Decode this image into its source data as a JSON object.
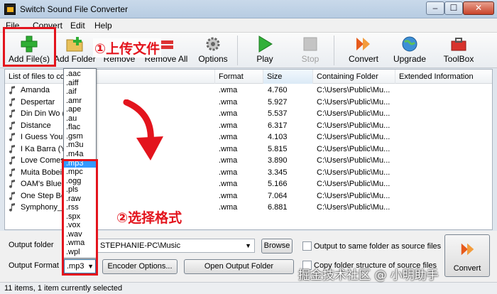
{
  "window": {
    "title": "Switch Sound File Converter"
  },
  "menu": [
    "File",
    "Convert",
    "Edit",
    "Help"
  ],
  "toolbar": {
    "add_files": "Add File(s)",
    "add_folder": "Add Folder",
    "remove": "Remove",
    "remove_all": "Remove All",
    "options": "Options",
    "play": "Play",
    "stop": "Stop",
    "convert": "Convert",
    "upgrade": "Upgrade",
    "toolbox": "ToolBox"
  },
  "list": {
    "columns": {
      "name": "List of files to co",
      "format": "Format",
      "size": "Size",
      "folder": "Containing Folder",
      "extended": "Extended Information"
    },
    "rows": [
      {
        "name": "Amanda",
        "format": ".wma",
        "size": "4.760",
        "folder": "C:\\Users\\Public\\Mu..."
      },
      {
        "name": "Despertar",
        "format": ".wma",
        "size": "5.927",
        "folder": "C:\\Users\\Public\\Mu..."
      },
      {
        "name": "Din Din Wo (I",
        "format": ".wma",
        "size": "5.537",
        "folder": "C:\\Users\\Public\\Mu..."
      },
      {
        "name": "Distance",
        "format": ".wma",
        "size": "6.317",
        "folder": "C:\\Users\\Public\\Mu..."
      },
      {
        "name": "I Guess You'",
        "format": ".wma",
        "size": "4.103",
        "folder": "C:\\Users\\Public\\Mu..."
      },
      {
        "name": "I Ka Barra (Y",
        "format": ".wma",
        "size": "5.815",
        "folder": "C:\\Users\\Public\\Mu..."
      },
      {
        "name": "Love Comes",
        "format": ".wma",
        "size": "3.890",
        "folder": "C:\\Users\\Public\\Mu..."
      },
      {
        "name": "Muita Bobeir",
        "format": ".wma",
        "size": "3.345",
        "folder": "C:\\Users\\Public\\Mu..."
      },
      {
        "name": "OAM's Blues",
        "format": ".wma",
        "size": "5.166",
        "folder": "C:\\Users\\Public\\Mu..."
      },
      {
        "name": "One Step Be",
        "format": ".wma",
        "size": "7.064",
        "folder": "C:\\Users\\Public\\Mu..."
      },
      {
        "name": "Symphony_N",
        "format": ".wma",
        "size": "6.881",
        "folder": "C:\\Users\\Public\\Mu..."
      }
    ]
  },
  "format_dropdown": {
    "options": [
      ".aac",
      ".aiff",
      ".aif",
      ".amr",
      ".ape",
      ".au",
      ".flac",
      ".gsm",
      ".m3u",
      ".m4a",
      ".mp3",
      ".mpc",
      ".ogg",
      ".pls",
      ".raw",
      ".rss",
      ".spx",
      ".vox",
      ".wav",
      ".wma",
      ".wpl"
    ],
    "selected": ".mp3"
  },
  "bottom": {
    "output_folder_label": "Output folder",
    "output_folder_value": "STEPHANIE-PC\\Music",
    "browse": "Browse",
    "same_folder": "Output to same folder as source files",
    "copy_structure": "Copy folder structure of source files",
    "output_format_label": "Output Format",
    "output_format_value": ".mp3",
    "encoder_options": "Encoder Options...",
    "open_output_folder": "Open Output Folder",
    "convert": "Convert"
  },
  "status": "11 items, 1 item currently selected",
  "annotations": {
    "upload": "①上传文件",
    "choose_format": "②选择格式",
    "watermark": "掘金技术社区 @ 小明助手"
  },
  "colors": {
    "annotation": "#e3141d",
    "selection": "#3399ff"
  }
}
